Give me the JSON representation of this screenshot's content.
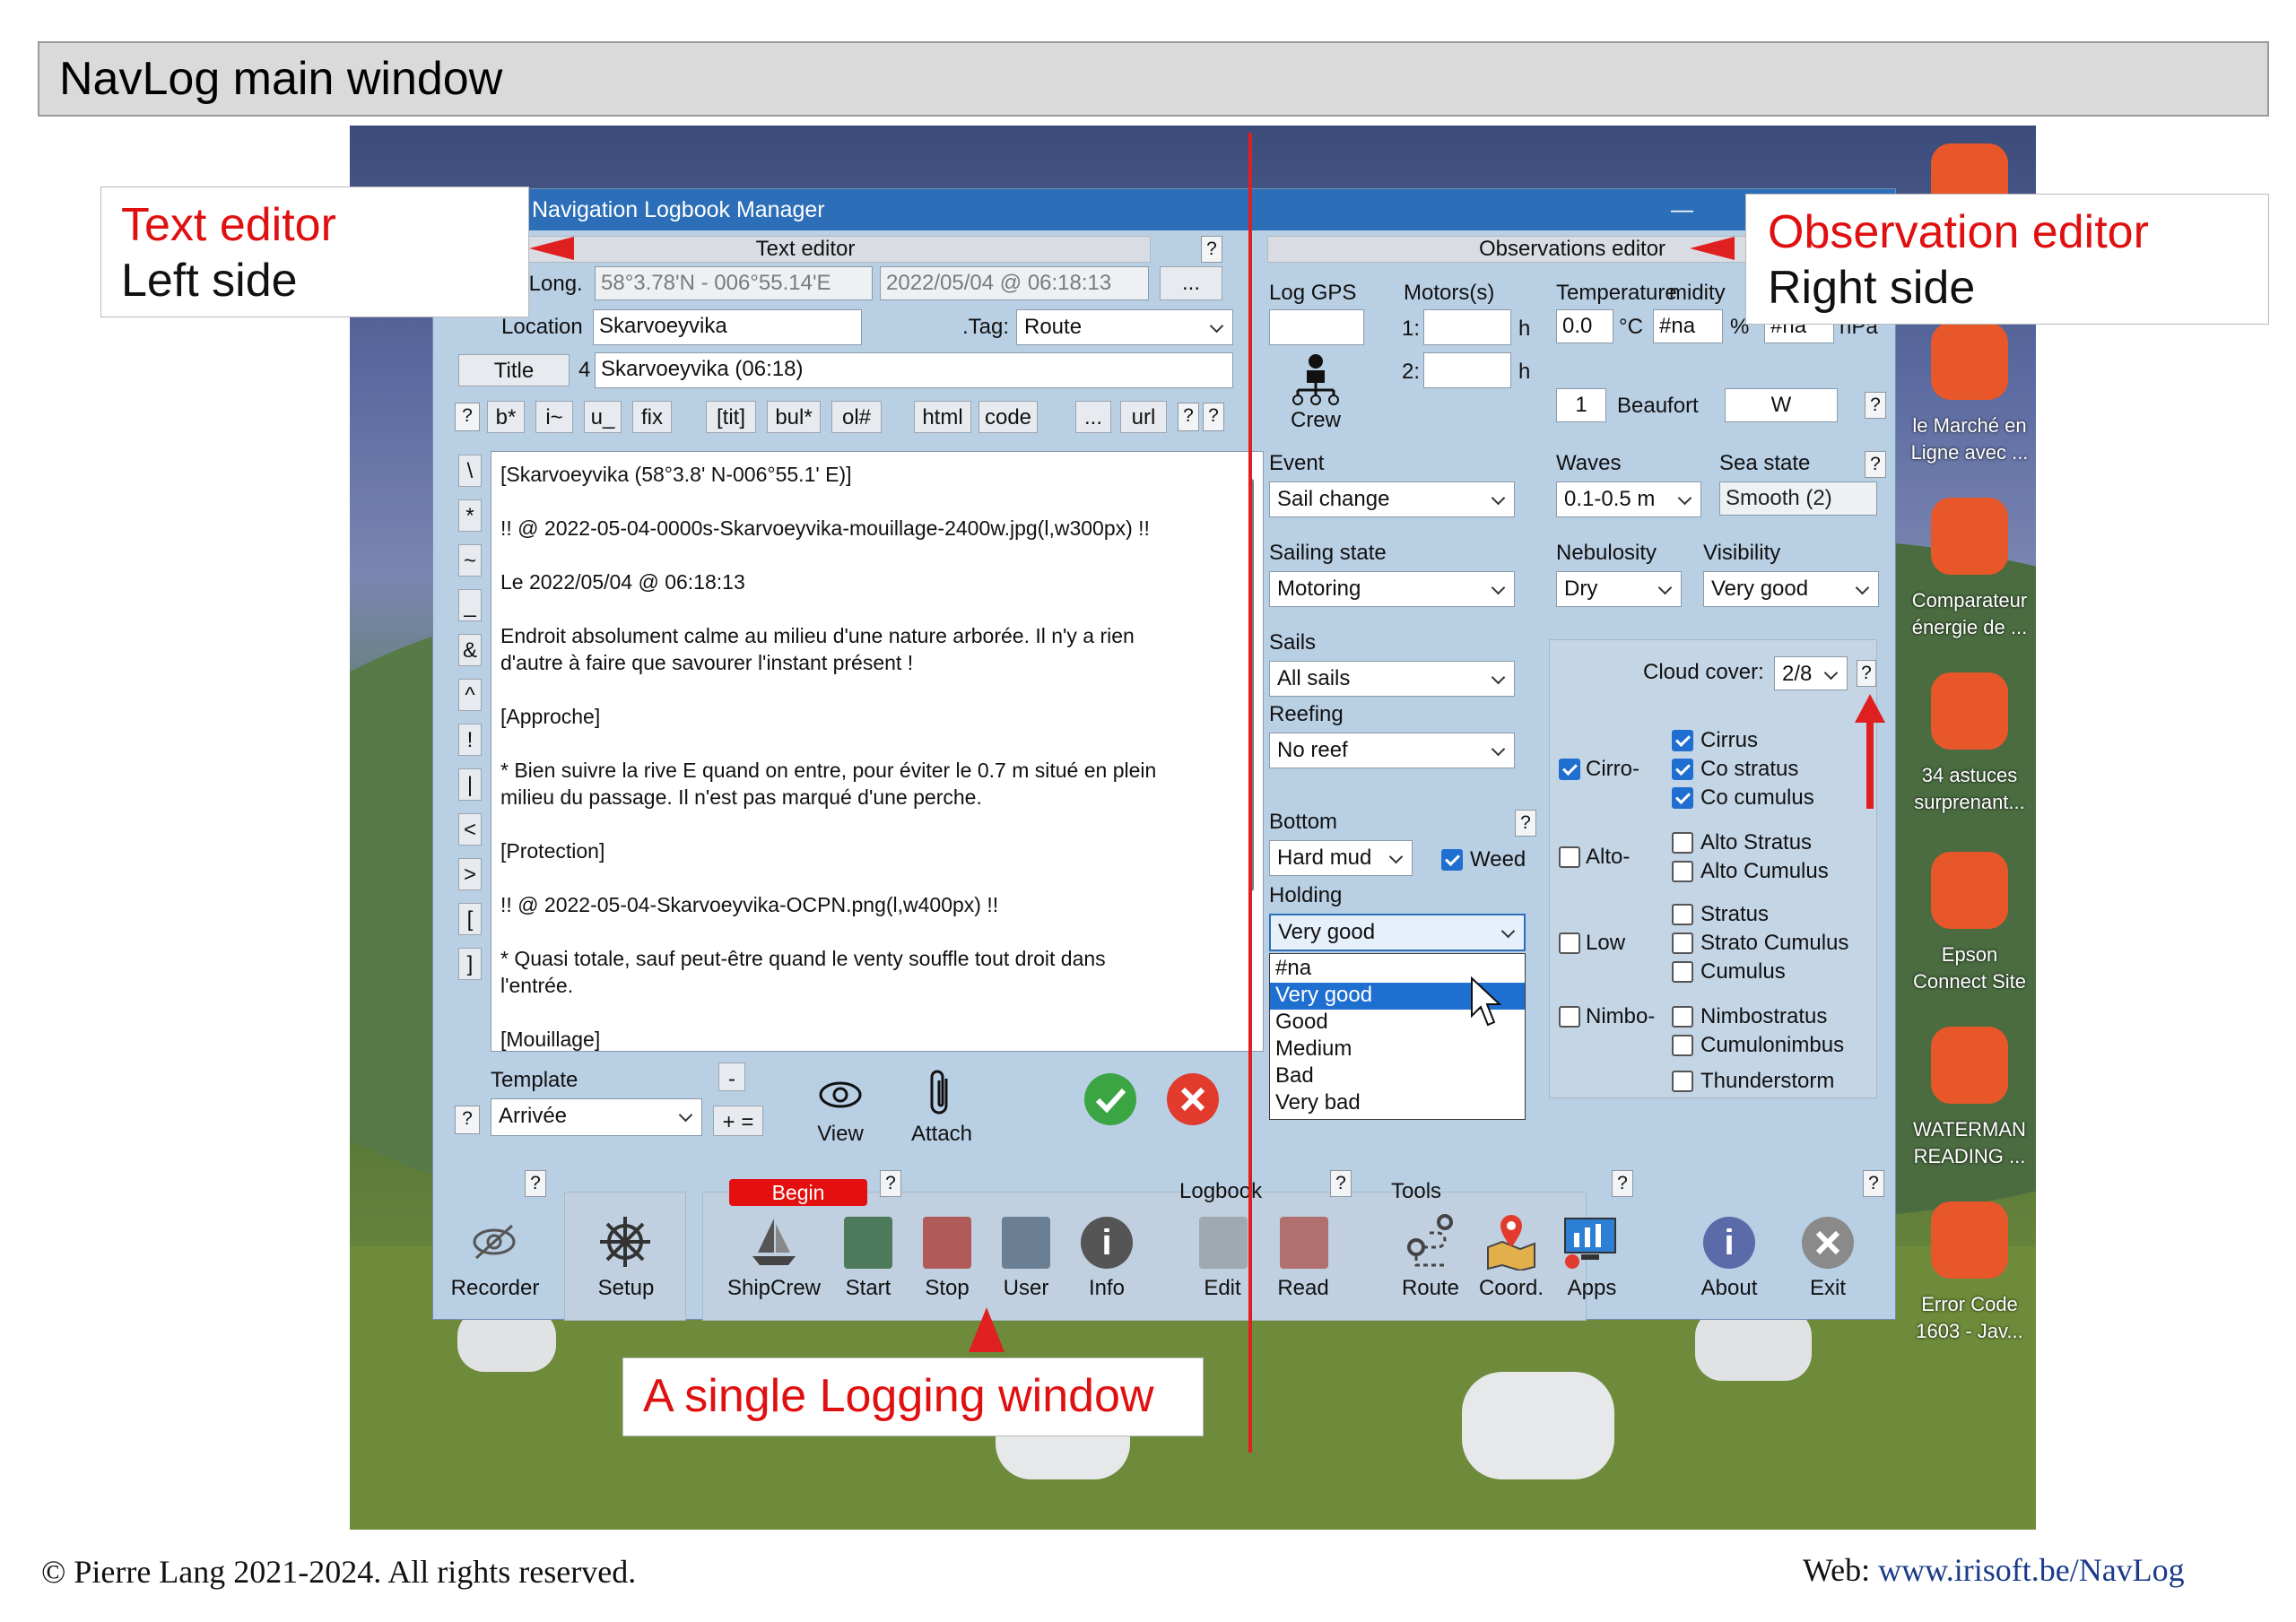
{
  "banner": {
    "title": "NavLog main window"
  },
  "window": {
    "title": "Navigation Logbook Manager",
    "minimize": "—"
  },
  "text_editor": {
    "header": "Text editor",
    "latlong_label": "/Long.",
    "latlong_value": "58°3.78'N - 006°55.14'E",
    "datetime_value": "2022/05/04 @ 06:18:13",
    "more_button": "...",
    "location_label": "Location",
    "location_value": "Skarvoeyvika",
    "tag_label": ".Tag:",
    "tag_value": "Route",
    "title_button": "Title",
    "title_num": "4",
    "title_value": "Skarvoeyvika (06:18)",
    "format_buttons": [
      "?",
      "b*",
      "i~",
      "u_",
      "fix",
      "[tit]",
      "bul*",
      "ol#",
      "html",
      "code",
      "...",
      "url",
      "?",
      "?"
    ],
    "side_buttons": [
      "\\",
      "*",
      "~",
      "_",
      "&",
      "^",
      "!",
      "|",
      "<",
      ">",
      "[",
      "]"
    ],
    "lines": [
      "[Skarvoeyvika (58°3.8' N-006°55.1' E)]",
      "!! @ 2022-05-04-0000s-Skarvoeyvika-mouillage-2400w.jpg(l,w300px) !!",
      "Le 2022/05/04 @ 06:18:13",
      "Endroit absolument calme au milieu d'une nature arborée. Il n'y a rien",
      "d'autre à faire que savourer l'instant présent !",
      "[Approche]",
      "* Bien suivre la rive E quand on entre, pour éviter le 0.7 m situé en plein",
      "milieu du passage. Il n'est pas marqué d'une perche.",
      "[Protection]",
      "!! @ 2022-05-04-Skarvoeyvika-OCPN.png(l,w400px) !!",
      "* Quasi totale, sauf peut-être quand le venty souffle tout droit dans",
      "l'entrée.",
      "[Mouillage]"
    ],
    "template_label": "Template",
    "template_value": "Arrivée",
    "template_minus": "-",
    "template_plus": "+ =",
    "help": "?",
    "view_label": "View",
    "attach_label": "Attach"
  },
  "obs_editor": {
    "header": "Observations editor",
    "log_gps": "Log GPS",
    "crew": "Crew",
    "motors_label": "Motors(s)",
    "motor1": "1:",
    "motor2": "2:",
    "h": "h",
    "temp_label": "Temperature",
    "humidity_label": "midity",
    "temp_value": "0.0",
    "temp_unit": "°C",
    "humidity_value": "#na",
    "humidity_unit": "%",
    "pressure_value": "#na",
    "pressure_unit": "hPa",
    "beaufort_value": "1",
    "beaufort_label": "Beaufort",
    "wind_dir": "W",
    "event_label": "Event",
    "event_value": "Sail change",
    "waves_label": "Waves",
    "waves_value": "0.1-0.5 m",
    "seastate_label": "Sea state",
    "seastate_value": "Smooth (2)",
    "sailing_label": "Sailing state",
    "sailing_value": "Motoring",
    "nebulosity_label": "Nebulosity",
    "nebulosity_value": "Dry",
    "visibility_label": "Visibility",
    "visibility_value": "Very good",
    "sails_label": "Sails",
    "sails_value": "All sails",
    "reefing_label": "Reefing",
    "reefing_value": "No reef",
    "bottom_label": "Bottom",
    "bottom_value": "Hard mud",
    "weed_label": "Weed",
    "holding_label": "Holding",
    "holding_value": "Very good",
    "holding_options": [
      "#na",
      "Very good",
      "Good",
      "Medium",
      "Bad",
      "Very bad"
    ],
    "cloud_cover_label": "Cloud cover:",
    "cloud_cover_value": "2/8",
    "cirro": "Cirro-",
    "alto": "Alto-",
    "low": "Low",
    "nimbo": "Nimbo-",
    "clouds": [
      "Cirrus",
      "Co stratus",
      "Co cumulus",
      "Alto Stratus",
      "Alto Cumulus",
      "Stratus",
      "Strato Cumulus",
      "Cumulus",
      "Nimbostratus",
      "Cumulonimbus",
      "Thunderstorm"
    ],
    "help": "?"
  },
  "toolbar": {
    "recorder": "Recorder",
    "setup": "Setup",
    "begin": "Begin",
    "shipcrew": "ShipCrew",
    "start": "Start",
    "stop": "Stop",
    "user": "User",
    "info": "Info",
    "logbook": "Logbook",
    "edit": "Edit",
    "read": "Read",
    "tools": "Tools",
    "route": "Route",
    "coord": "Coord.",
    "apps": "Apps",
    "about": "About",
    "exit": "Exit",
    "help": "?"
  },
  "callouts": {
    "text_editor_title": "Text editor",
    "text_editor_sub": "Left side",
    "obs_title": "Observation editor",
    "obs_sub": "Right side",
    "logging": "A single Logging window"
  },
  "desktop_icons": [
    "le Marché en Ligne avec ...",
    "Comparateur énergie de ...",
    "34 astuces surprenant...",
    "Epson Connect Site",
    "WATERMAN READING ...",
    "Error Code 1603 - Jav..."
  ],
  "footer": {
    "copyright": "© Pierre Lang 2021-2024. All rights reserved.",
    "web_label": "Web:",
    "web_url": "www.irisoft.be/NavLog"
  },
  "colors": {
    "accent_red": "#e01010",
    "titlebar": "#2c6fb8",
    "window_bg": "#b9cfe4",
    "link": "#1a3a8a"
  }
}
